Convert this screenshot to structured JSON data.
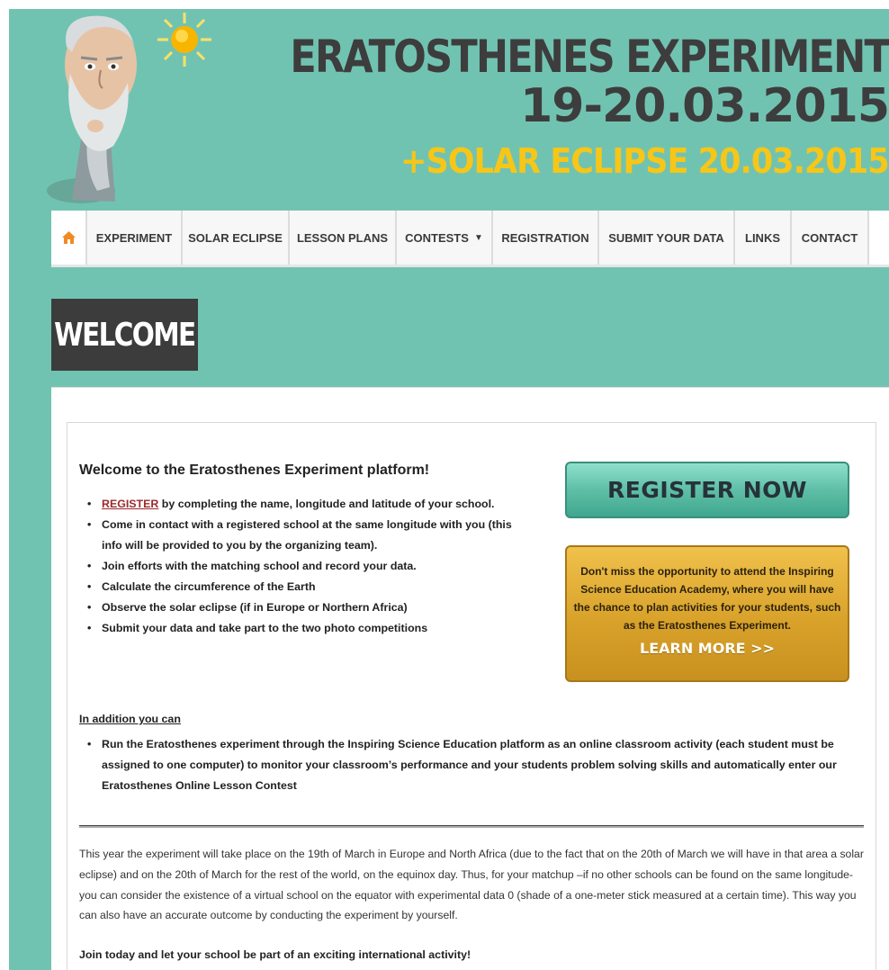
{
  "header": {
    "title_line1": "ERATOSTHENES EXPERIMENT",
    "title_line2": "19-20.03.2015",
    "title_line3": "+SOLAR ECLIPSE 20.03.2015"
  },
  "nav": {
    "home_icon": "home-icon",
    "items": [
      {
        "label": "EXPERIMENT"
      },
      {
        "label": "SOLAR ECLIPSE"
      },
      {
        "label": "LESSON PLANS"
      },
      {
        "label": "CONTESTS"
      },
      {
        "label": "REGISTRATION"
      },
      {
        "label": "SUBMIT YOUR DATA"
      },
      {
        "label": "LINKS"
      },
      {
        "label": "CONTACT"
      }
    ]
  },
  "page": {
    "welcome_heading": "WELCOME"
  },
  "intro": {
    "title": "Welcome to the Eratosthenes Experiment platform!",
    "register_link": "REGISTER",
    "bullet1_rest": " by completing the name, longitude and latitude of your school.",
    "bullets": [
      "Come in contact with a registered school at the same longitude with you (this info will be provided to you by the organizing team).",
      "Join efforts with the matching school and record your data.",
      "Calculate the circumference of the Earth",
      "Observe the solar eclipse (if in Europe or Northern Africa)",
      "Submit your data and take part to the two photo competitions"
    ]
  },
  "register_button": {
    "label": "REGISTER NOW"
  },
  "promo": {
    "text": "Don't miss the opportunity to attend the Inspiring Science Education Academy, where you will have the chance to plan activities for your students, such as the Eratosthenes Experiment.",
    "button": "LEARN MORE >>"
  },
  "addition": {
    "title": "In addition you can",
    "items": [
      "Run the Eratosthenes experiment through the Inspiring Science Education platform as an online classroom activity (each student must be assigned to one computer) to monitor your classroom’s performance and your students problem solving skills and automatically enter our Eratosthenes Online Lesson Contest"
    ]
  },
  "body_text": {
    "paragraph": "This year the experiment will take place on the 19th of March in Europe and North Africa (due to the fact that on the 20th of March we will have in that area a solar eclipse) and on the 20th of March for the rest of the world, on the equinox day. Thus, for your matchup –if no other schools can be found on the same longitude- you can consider the existence of a virtual school on the equator with experimental data 0 (shade of a one-meter stick measured at a certain time). This way you can also have an accurate outcome by conducting the experiment by yourself.",
    "join": "Join today and let your school be part of an exciting international activity!"
  },
  "colors": {
    "teal_background": "#71c3b1",
    "dark_title": "#3d3d3d",
    "yellow_title": "#f6c618",
    "register_green": "#5fbfa6",
    "promo_gold": "#d9a22a",
    "link_red": "#9b2a2a"
  }
}
